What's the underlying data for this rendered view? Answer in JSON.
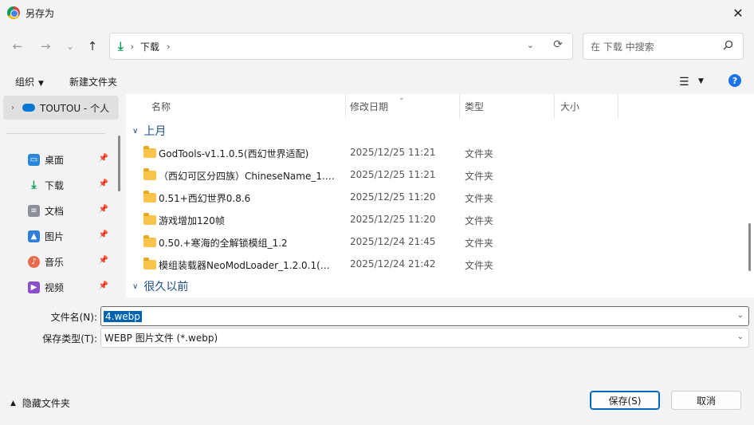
{
  "window": {
    "title": "另存为",
    "close_symbol": "✕"
  },
  "nav": {
    "back": "←",
    "forward": "→",
    "dropdown": "⌄",
    "up": "↑"
  },
  "address": {
    "folder": "下载",
    "sep": "›",
    "refresh": "⟳",
    "dropdown": "⌄"
  },
  "search": {
    "placeholder": "在 下载 中搜索"
  },
  "toolbar": {
    "organize": "组织",
    "new_folder": "新建文件夹",
    "help": "?"
  },
  "sidebar": {
    "top_item": "TOUTOU - 个人",
    "items": [
      {
        "label": "桌面",
        "icon": "desktop-icon",
        "color": "#2b88d8"
      },
      {
        "label": "下载",
        "icon": "download-icon",
        "color": "#0f9d58"
      },
      {
        "label": "文档",
        "icon": "document-icon",
        "color": "#8a8f99"
      },
      {
        "label": "图片",
        "icon": "picture-icon",
        "color": "#2f7ed8"
      },
      {
        "label": "音乐",
        "icon": "music-icon",
        "color": "#e86a4c"
      },
      {
        "label": "视频",
        "icon": "video-icon",
        "color": "#8a4ec9"
      }
    ]
  },
  "columns": {
    "name": "名称",
    "date": "修改日期",
    "type": "类型",
    "size": "大小"
  },
  "groups": {
    "last_month": "上月",
    "long_ago": "很久以前"
  },
  "files": [
    {
      "name": "GodTools-v1.1.0.5(西幻世界适配)",
      "date": "2025/12/25 11:21",
      "type": "文件夹"
    },
    {
      "name": "（西幻可区分四族）ChineseName_1.5....",
      "date": "2025/12/25 11:21",
      "type": "文件夹"
    },
    {
      "name": "0.51+西幻世界0.8.6",
      "date": "2025/12/25 11:20",
      "type": "文件夹"
    },
    {
      "name": "游戏增加120帧",
      "date": "2025/12/25 11:20",
      "type": "文件夹"
    },
    {
      "name": "0.50.+寒海的全解锁模组_1.2",
      "date": "2025/12/24 21:45",
      "type": "文件夹"
    },
    {
      "name": "模组装载器NeoModLoader_1.2.0.1(适...",
      "date": "2025/12/24 21:42",
      "type": "文件夹"
    }
  ],
  "form": {
    "filename_label": "文件名(N):",
    "filename_value": "4.webp",
    "filetype_label": "保存类型(T):",
    "filetype_value": "WEBP 图片文件 (*.webp)"
  },
  "footer": {
    "hide_folders": "隐藏文件夹",
    "save": "保存(S)",
    "cancel": "取消"
  },
  "colors": {
    "accent": "#0067c0",
    "selection": "#0063b1",
    "group_header": "#1f4f8b"
  }
}
